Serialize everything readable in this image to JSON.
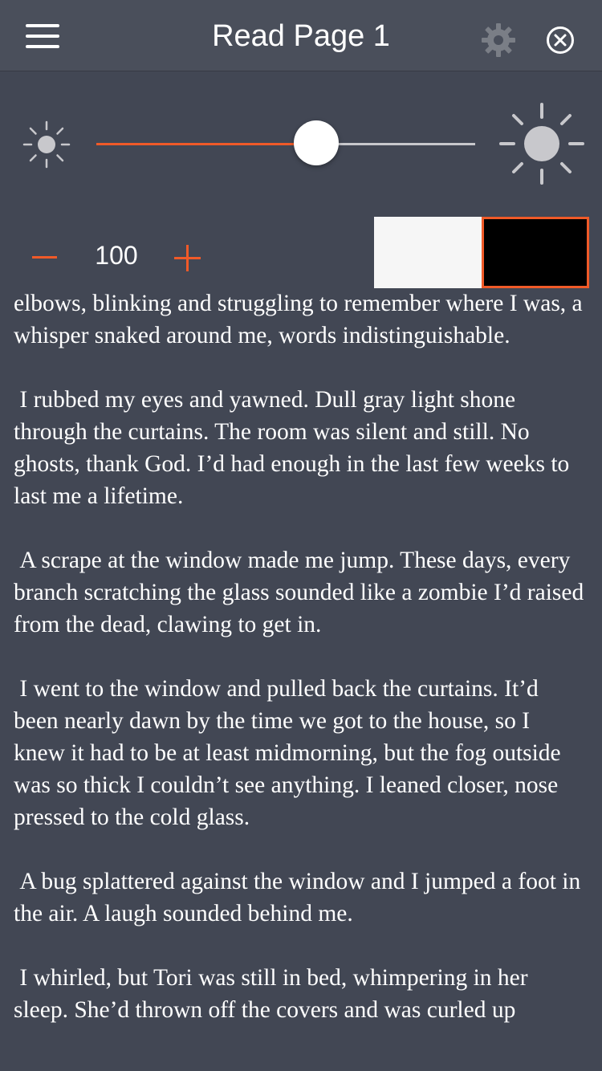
{
  "header": {
    "title": "Read Page 1",
    "menu_icon": "hamburger-menu-icon",
    "settings_icon": "gear-icon",
    "close_icon": "close-circle-icon"
  },
  "brightness": {
    "min_icon": "sun-small-icon",
    "max_icon": "sun-large-icon",
    "level": 0.58,
    "fill_color": "#f05a28"
  },
  "font_size": {
    "decrease_label": "−",
    "value": "100",
    "increase_label": "+"
  },
  "themes": {
    "options": [
      "white",
      "black"
    ],
    "selected": "black",
    "accent_color": "#f05a28"
  },
  "colors": {
    "background": "#424754",
    "accent": "#f05a28"
  },
  "content": {
    "paragraphs": [
      "elbows, blinking and struggling to remember where I was, a whisper snaked around me, words indistinguishable.",
      " I rubbed my eyes and yawned. Dull gray light shone through the curtains. The room was silent and still. No ghosts, thank God. I’d had enough in the last few weeks to last me a lifetime.",
      " A scrape at the window made me jump. These days, every branch scratching the glass sounded like a zombie I’d raised from the dead, clawing to get in.",
      " I went to the window and pulled back the curtains. It’d been nearly dawn by the time we got to the house, so I knew it had to be at least midmorning, but the fog outside was so thick I couldn’t see anything. I leaned closer, nose pressed to the cold glass.",
      " A bug splattered against the window and I jumped a foot in the air. A laugh sounded behind me.",
      " I whirled, but Tori was still in bed, whimpering in her sleep. She’d thrown off the covers and was curled up"
    ]
  }
}
